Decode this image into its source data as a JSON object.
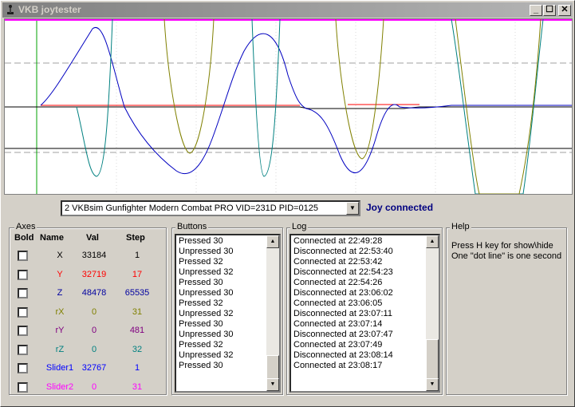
{
  "window": {
    "title": "VKB joytester",
    "minimize": "_",
    "maximize": "☐",
    "close": "✕"
  },
  "device": {
    "selected": "2 VKBsim Gunfighter Modern Combat PRO  VID=231D PID=0125",
    "status": "Joy connected"
  },
  "axes": {
    "label": "Axes",
    "headers": {
      "bold": "Bold",
      "name": "Name",
      "val": "Val",
      "step": "Step"
    },
    "rows": [
      {
        "name": "X",
        "val": "33184",
        "step": "1",
        "color": "#000000"
      },
      {
        "name": "Y",
        "val": "32719",
        "step": "17",
        "color": "#ff0000"
      },
      {
        "name": "Z",
        "val": "48478",
        "step": "65535",
        "color": "#0000a0"
      },
      {
        "name": "rX",
        "val": "0",
        "step": "31",
        "color": "#808000"
      },
      {
        "name": "rY",
        "val": "0",
        "step": "481",
        "color": "#800080"
      },
      {
        "name": "rZ",
        "val": "0",
        "step": "32",
        "color": "#008080"
      },
      {
        "name": "Slider1",
        "val": "32767",
        "step": "1",
        "color": "#0000ff"
      },
      {
        "name": "Slider2",
        "val": "0",
        "step": "31",
        "color": "#ff00ff"
      }
    ]
  },
  "buttons": {
    "label": "Buttons",
    "items": [
      "Pressed 30",
      "Unpressed 30",
      "Pressed 32",
      "Unpressed 32",
      "Pressed 30",
      "Unpressed 30",
      "Pressed 32",
      "Unpressed 32",
      "Pressed 30",
      "Unpressed 30",
      "Pressed 32",
      "Unpressed 32",
      "Pressed 30"
    ]
  },
  "log": {
    "label": "Log",
    "items": [
      "Connected at 22:49:28",
      "Disconnected at 22:53:40",
      "Connected at 22:53:42",
      "Disconnected at 22:54:23",
      "Connected at 22:54:26",
      "Disconnected at 23:06:02",
      "Connected at 23:06:05",
      "Disconnected at 23:07:11",
      "Connected at 23:07:14",
      "Disconnected at 23:07:47",
      "Connected at 23:07:49",
      "Disconnected at 23:08:14",
      "Connected at 23:08:17"
    ]
  },
  "help": {
    "label": "Help",
    "line1": "Press H key for show\\hide",
    "line2": "One \"dot line\" is one second"
  },
  "scrollbar": {
    "up": "▲",
    "down": "▼"
  },
  "dropdown_arrow": "▼"
}
